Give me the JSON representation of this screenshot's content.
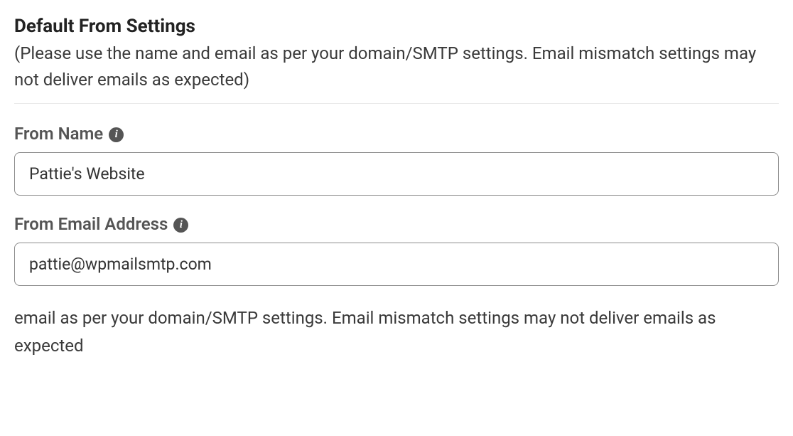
{
  "section": {
    "title": "Default From Settings",
    "description": "(Please use the name and email as per your domain/SMTP settings. Email mismatch settings may not deliver emails as expected)"
  },
  "fields": {
    "from_name": {
      "label": "From Name",
      "value": "Pattie's Website"
    },
    "from_email": {
      "label": "From Email Address",
      "value": "pattie@wpmailsmtp.com"
    }
  },
  "footer_text": "email as per your domain/SMTP settings. Email mismatch settings may not deliver emails as expected"
}
